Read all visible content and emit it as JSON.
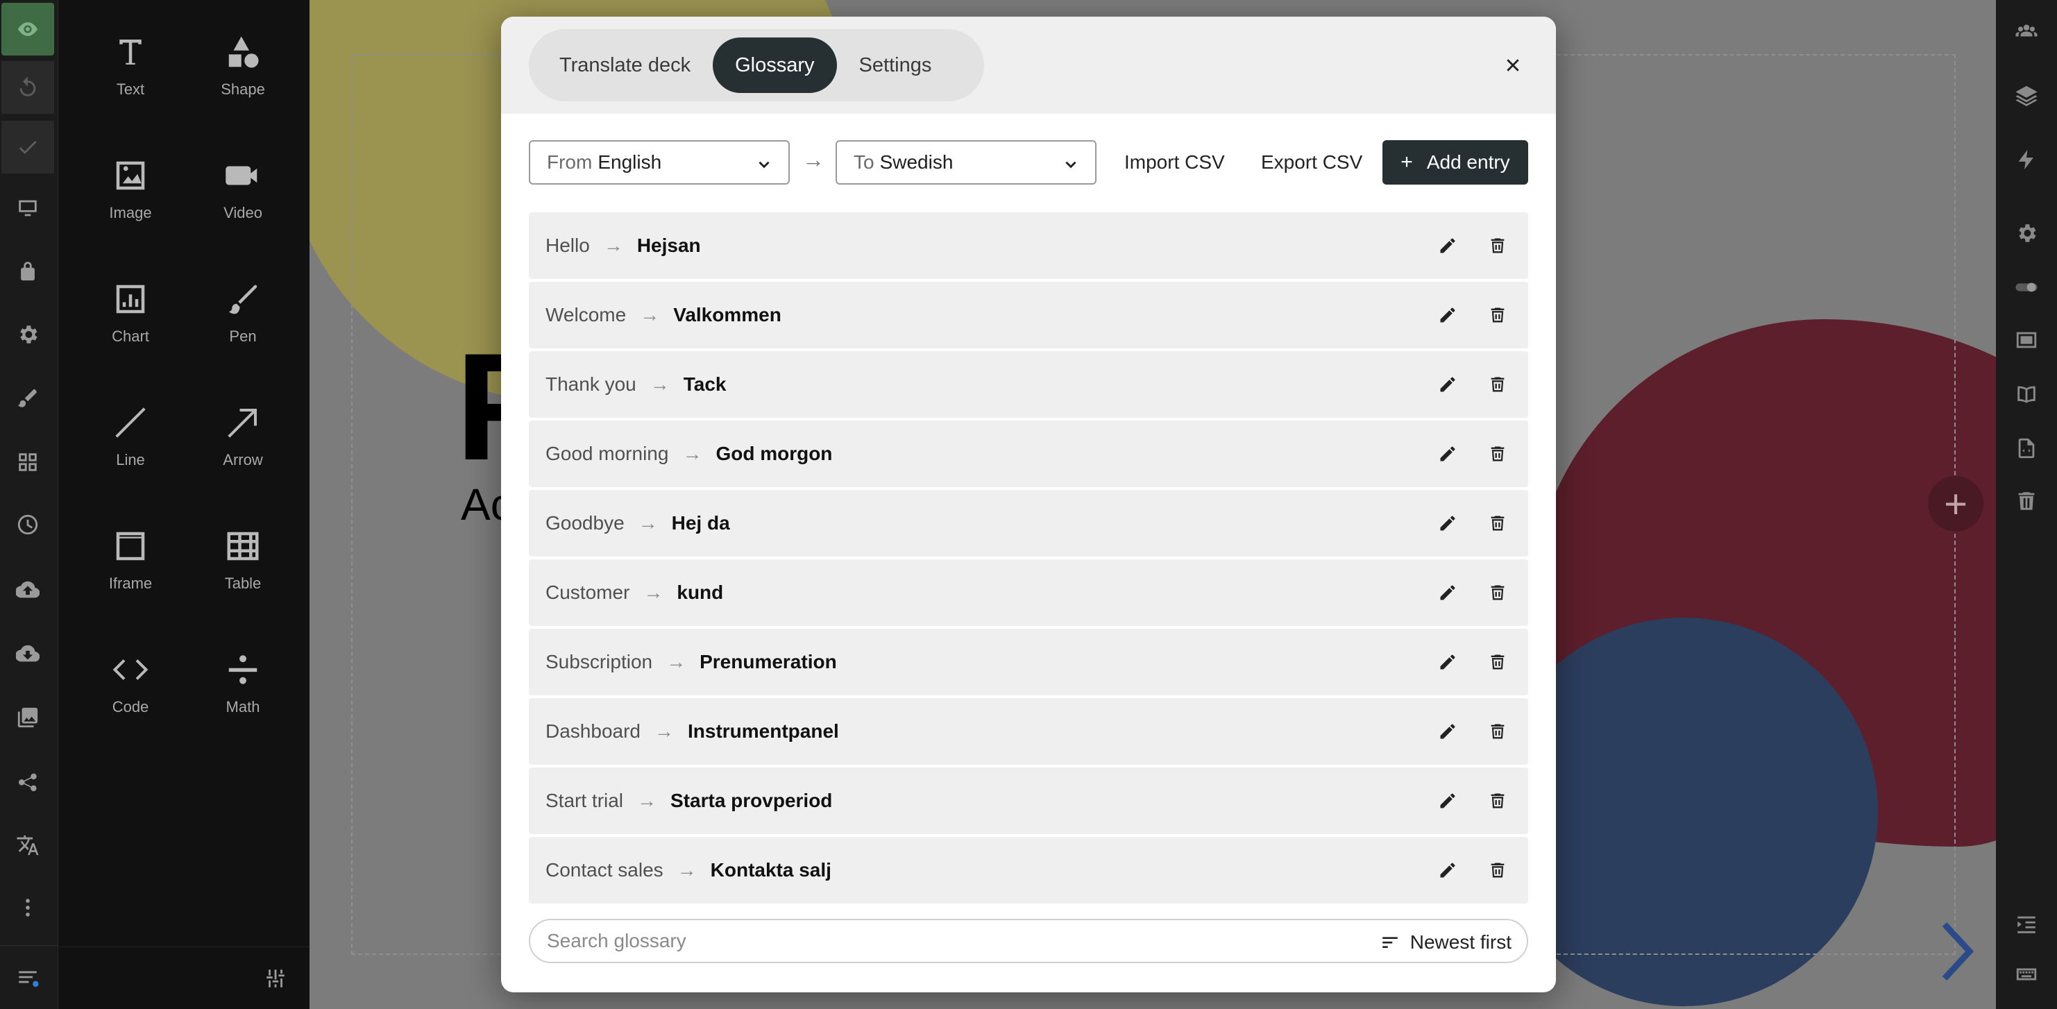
{
  "tools": [
    {
      "label": "Text",
      "icon": "text-icon"
    },
    {
      "label": "Shape",
      "icon": "shape-icon"
    },
    {
      "label": "Image",
      "icon": "image-icon"
    },
    {
      "label": "Video",
      "icon": "video-icon"
    },
    {
      "label": "Chart",
      "icon": "chart-icon"
    },
    {
      "label": "Pen",
      "icon": "pen-icon"
    },
    {
      "label": "Line",
      "icon": "line-icon"
    },
    {
      "label": "Arrow",
      "icon": "arrow-icon"
    },
    {
      "label": "Iframe",
      "icon": "iframe-icon"
    },
    {
      "label": "Table",
      "icon": "table-icon"
    },
    {
      "label": "Code",
      "icon": "code-icon"
    },
    {
      "label": "Math",
      "icon": "math-icon"
    }
  ],
  "slide": {
    "big_letter": "F",
    "sub_text": "Ac"
  },
  "modal": {
    "tabs": [
      {
        "label": "Translate deck",
        "active": false
      },
      {
        "label": "Glossary",
        "active": true
      },
      {
        "label": "Settings",
        "active": false
      }
    ],
    "from_prefix": "From",
    "from_value": "English",
    "to_prefix": "To",
    "to_value": "Swedish",
    "arrow": "→",
    "import_label": "Import CSV",
    "export_label": "Export CSV",
    "add_label": "Add entry",
    "search_placeholder": "Search glossary",
    "sort_label": "Newest first"
  },
  "glossary": [
    {
      "source": "Hello",
      "target": "Hejsan"
    },
    {
      "source": "Welcome",
      "target": "Valkommen"
    },
    {
      "source": "Thank you",
      "target": "Tack"
    },
    {
      "source": "Good morning",
      "target": "God morgon"
    },
    {
      "source": "Goodbye",
      "target": "Hej da"
    },
    {
      "source": "Customer",
      "target": "kund"
    },
    {
      "source": "Subscription",
      "target": "Prenumeration"
    },
    {
      "source": "Dashboard",
      "target": "Instrumentpanel"
    },
    {
      "source": "Start trial",
      "target": "Starta provperiod"
    },
    {
      "source": "Contact sales",
      "target": "Kontakta salj"
    }
  ],
  "colors": {
    "accent_dark": "#263033",
    "preview_green": "#3f6b45",
    "blob_red": "#5c1f2b",
    "blob_blue": "#2c3e5e",
    "blob_yellow": "#9b9350"
  }
}
